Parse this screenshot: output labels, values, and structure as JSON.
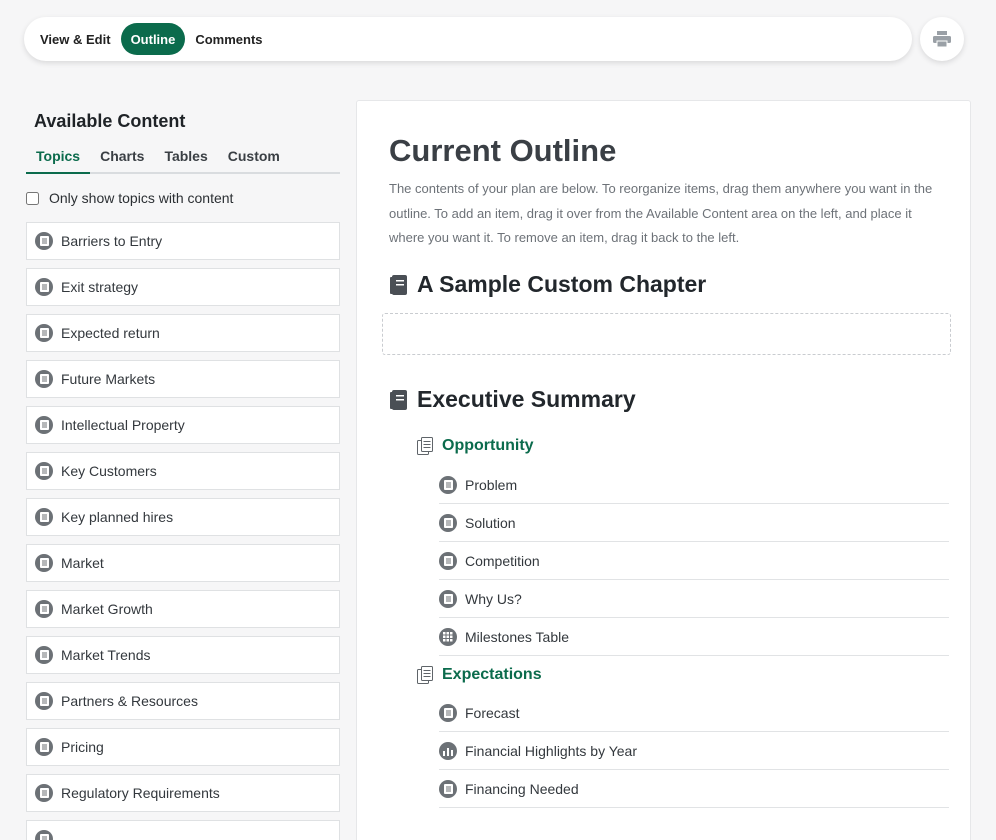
{
  "top_tabs": [
    {
      "label": "View & Edit",
      "active": false
    },
    {
      "label": "Outline",
      "active": true
    },
    {
      "label": "Comments",
      "active": false
    }
  ],
  "print_icon": "printer-icon",
  "left_panel": {
    "title": "Available Content",
    "tabs": [
      "Topics",
      "Charts",
      "Tables",
      "Custom"
    ],
    "active_tab": "Topics",
    "filter_label": "Only show topics with content",
    "filter_checked": false,
    "topics": [
      "Barriers to Entry",
      "Exit strategy",
      "Expected return",
      "Future Markets",
      "Intellectual Property",
      "Key Customers",
      "Key planned hires",
      "Market",
      "Market Growth",
      "Market Trends",
      "Partners & Resources",
      "Pricing",
      "Regulatory Requirements",
      ""
    ]
  },
  "outline": {
    "title": "Current Outline",
    "description": "The contents of your plan are below. To reorganize items, drag them anywhere you want in the outline. To add an item, drag it over from the Available Content area on the left, and place it where you want it. To remove an item, drag it back to the left.",
    "chapters": [
      {
        "title": "A Sample Custom Chapter"
      },
      {
        "title": "Executive Summary"
      }
    ],
    "sections": [
      {
        "title": "Opportunity",
        "items": [
          {
            "label": "Problem",
            "icon": "document-icon"
          },
          {
            "label": "Solution",
            "icon": "document-icon"
          },
          {
            "label": "Competition",
            "icon": "document-icon"
          },
          {
            "label": "Why Us?",
            "icon": "document-icon"
          },
          {
            "label": "Milestones Table",
            "icon": "table-icon"
          }
        ]
      },
      {
        "title": "Expectations",
        "items": [
          {
            "label": "Forecast",
            "icon": "document-icon"
          },
          {
            "label": "Financial Highlights by Year",
            "icon": "chart-icon"
          },
          {
            "label": "Financing Needed",
            "icon": "document-icon"
          }
        ]
      }
    ]
  },
  "colors": {
    "accent": "#0b6b4c",
    "icon_gray": "#6c7176"
  }
}
